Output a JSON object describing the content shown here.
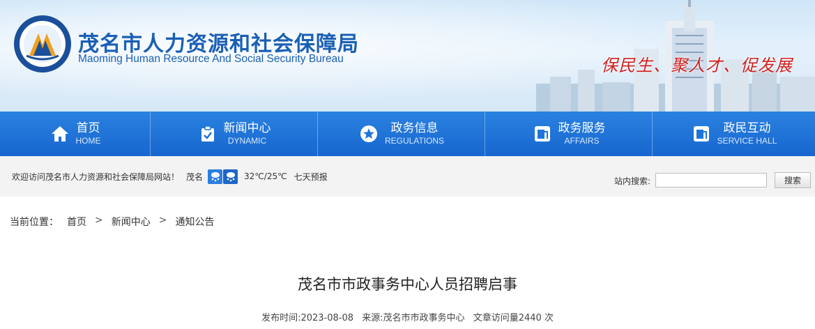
{
  "header": {
    "title_cn": "茂名市人力资源和社会保障局",
    "title_en": "Maoming Human Resource And Social Security Bureau",
    "slogan": "保民生、聚人才、促发展"
  },
  "nav": [
    {
      "label": "首页",
      "sub": "HOME",
      "icon": "home-icon"
    },
    {
      "label": "新闻中心",
      "sub": "DYNAMIC",
      "icon": "clipboard-check-icon"
    },
    {
      "label": "政务信息",
      "sub": "REGULATIONS",
      "icon": "star-circle-icon"
    },
    {
      "label": "政务服务",
      "sub": "AFFAIRS",
      "icon": "service-window-icon"
    },
    {
      "label": "政民互动",
      "sub": "SERVICE HALL",
      "icon": "interaction-window-icon"
    }
  ],
  "infobar": {
    "welcome": "欢迎访问茂名市人力资源和社会保障局网站！",
    "city": "茂名",
    "temperature": "32℃/25℃",
    "forecast": "七天预报",
    "search_label": "站内搜索:",
    "search_value": "",
    "search_button": "搜索"
  },
  "breadcrumb": {
    "prefix": "当前位置：",
    "items": [
      "首页",
      "新闻中心",
      "通知公告"
    ]
  },
  "article": {
    "title": "茂名市市政事务中心人员招聘启事",
    "publish_time": "发布时间:2023-08-08",
    "source": "来源:茂名市市政事务中心",
    "views": "文章访问量2440 次"
  },
  "colors": {
    "nav_blue": "#1f74d8",
    "title_blue": "#1a5fb4",
    "slogan_red": "#d11f1f"
  }
}
